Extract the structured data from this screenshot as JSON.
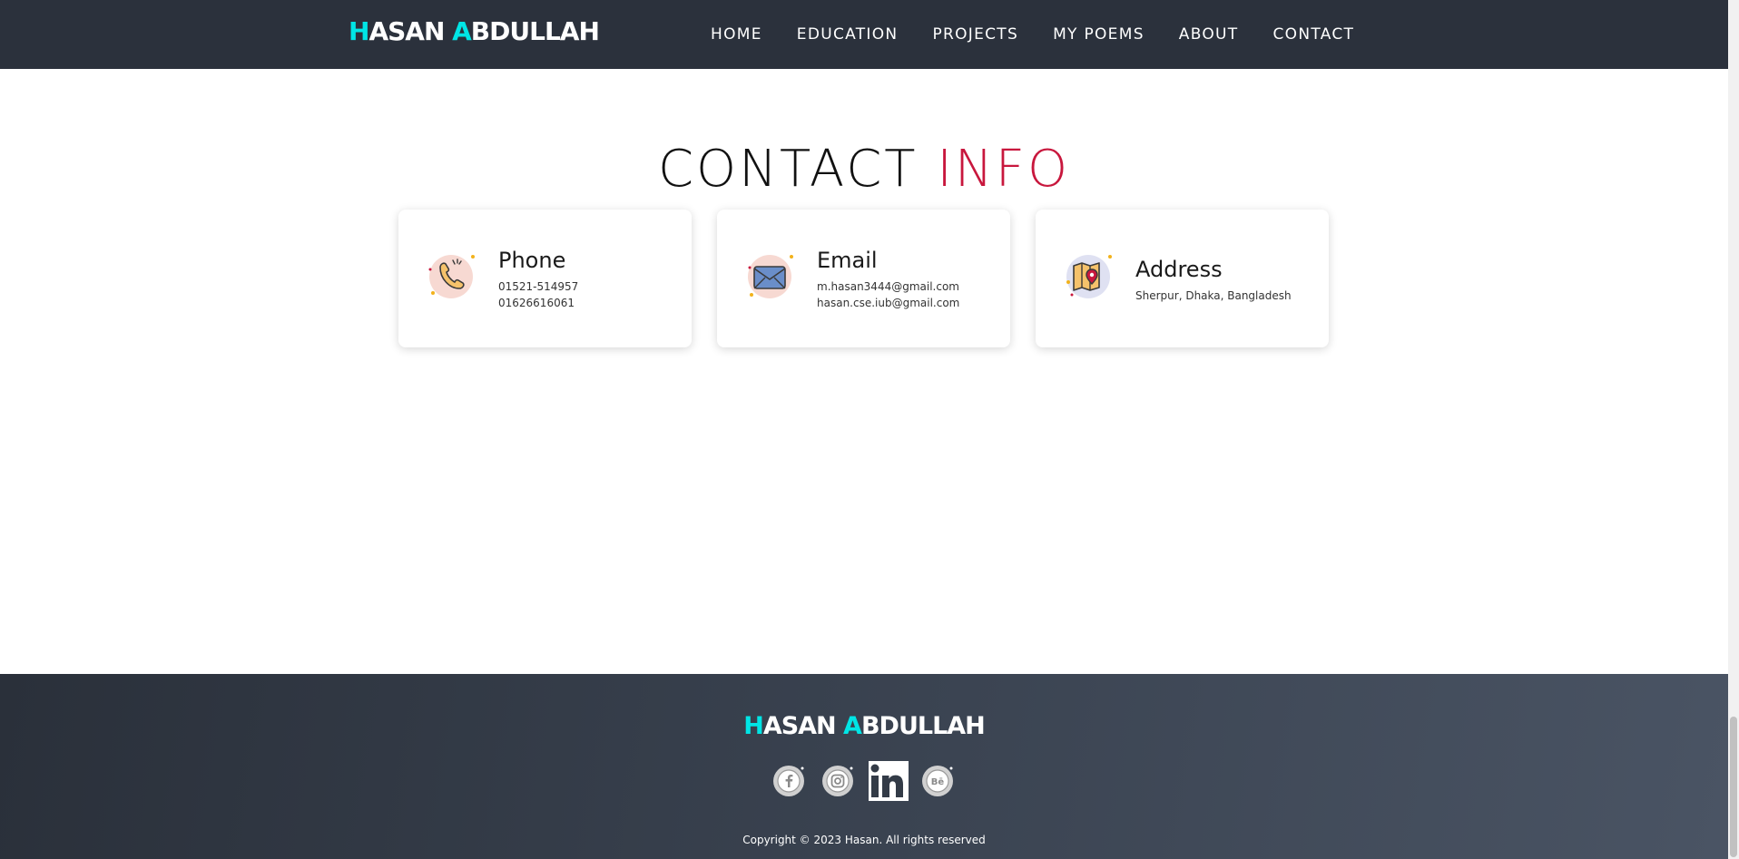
{
  "header": {
    "brand": {
      "h": "H",
      "rest1": "ASAN ",
      "a": "A",
      "rest2": "BDULLAH"
    },
    "nav": [
      "HOME",
      "EDUCATION",
      "PROJECTS",
      "MY POEMS",
      "ABOUT",
      "CONTACT"
    ]
  },
  "contact": {
    "title_a": "CONTACT",
    "title_b": "INFO",
    "cards": [
      {
        "title": "Phone",
        "lines": [
          "01521-514957",
          "01626616061"
        ],
        "icon": "phone-icon"
      },
      {
        "title": "Email",
        "lines": [
          "m.hasan3444@gmail.com",
          "hasan.cse.iub@gmail.com"
        ],
        "icon": "email-icon"
      },
      {
        "title": "Address",
        "lines": [
          "Sherpur, Dhaka, Bangladesh"
        ],
        "icon": "map-icon"
      }
    ]
  },
  "footer": {
    "brand": {
      "h": "H",
      "rest1": "ASAN ",
      "a": "A",
      "rest2": "BDULLAH"
    },
    "socials": [
      "facebook-icon",
      "instagram-icon",
      "linkedin-icon",
      "behance-icon"
    ],
    "copyright": "Copyright © 2023 Hasan. All rights reserved"
  },
  "colors": {
    "navbar_bg": "#2b313c",
    "accent_cyan": "#00e5e5",
    "accent_red": "#c8173d"
  }
}
